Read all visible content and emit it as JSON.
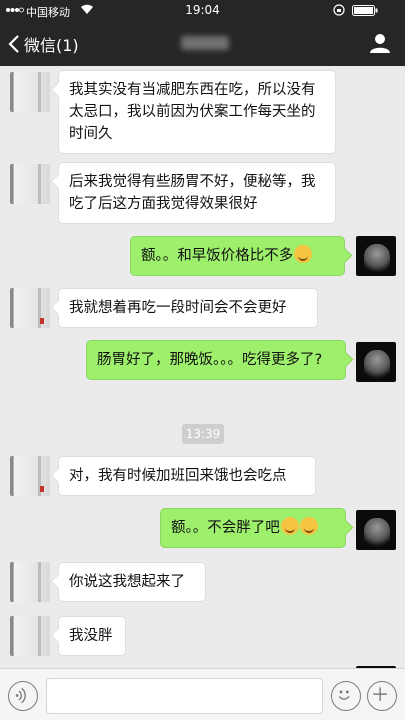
{
  "status_bar": {
    "carrier": "中国移动",
    "time": "19:04"
  },
  "nav": {
    "back_label": "微信(1)"
  },
  "messages": [
    {
      "dir": "in",
      "text": "我其实没有当减肥东西在吃，所以没有太忌口，我以前因为伏案工作每天坐的时间久"
    },
    {
      "dir": "in",
      "text": "后来我觉得有些肠胃不好，便秘等，我吃了后这方面我觉得效果很好"
    },
    {
      "dir": "out",
      "text": "额。。和早饭价格比不多"
    },
    {
      "dir": "in",
      "text": "我就想着再吃一段时间会不会更好"
    },
    {
      "dir": "out",
      "text": "肠胃好了，那晚饭。。。吃得更多了?"
    },
    {
      "dir": "in",
      "text": "对，我有时候加班回来饿也会吃点"
    },
    {
      "dir": "out",
      "text": "额。。不会胖了吧"
    },
    {
      "dir": "in",
      "text": "你说这我想起来了"
    },
    {
      "dir": "in",
      "text": "我没胖"
    }
  ],
  "timestamp": "13:39",
  "input": {
    "placeholder": ""
  }
}
